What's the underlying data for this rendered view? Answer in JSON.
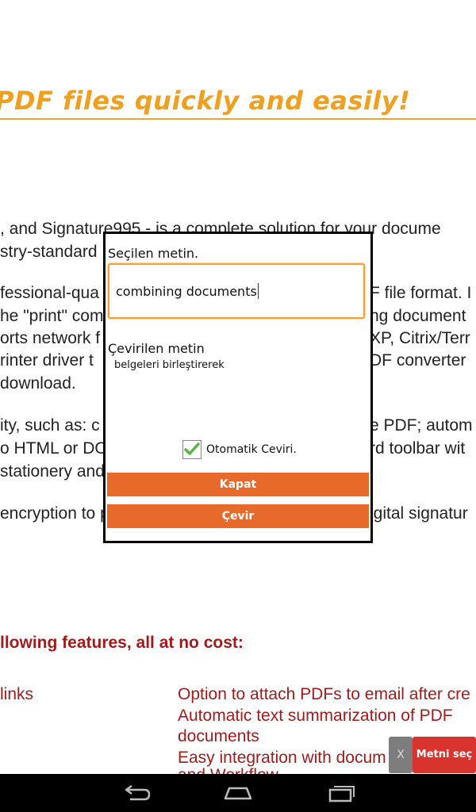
{
  "page": {
    "headline": "PDF files quickly and easily!",
    "body_lines": [
      ", and Signature995 - is a complete solution for your docume",
      "stry-standard",
      "fessional-qua",
      "he \"print\" com",
      "orts network f",
      "rinter driver t",
      "download.",
      "ity, such as: c",
      "o HTML or DO",
      "stationery and",
      "encryption to p"
    ],
    "body_right_lines": [
      "F file format. I",
      "ng document",
      "XP, Citrix/Terr",
      "DF converter",
      "e PDF; autom",
      "rd toolbar wit",
      "igital signatur"
    ],
    "features_heading": "llowing features, all at no cost:",
    "features_left": [
      "links"
    ],
    "features_right": [
      "Option to attach PDFs to email after cre",
      "Automatic text summarization of PDF",
      "documents",
      "Easy integration with docum",
      "and Workflow"
    ]
  },
  "dialog": {
    "source_label": "Seçilen metin.",
    "source_value": "combining documents",
    "translated_label": "Çevirilen metin",
    "translated_value": "belgeleri birleştirerek",
    "auto_label": "Otomatik Ceviri.",
    "auto_checked": true,
    "close_label": "Kapat",
    "translate_label": "Çevir"
  },
  "floating": {
    "dismiss_label": "X",
    "select_label": "Metni seç"
  },
  "colors": {
    "accent": "#e86a2a",
    "headline": "#f0a020",
    "feature_text": "#a01c1c",
    "select_button": "#d9332e"
  },
  "icons": {
    "nav_back": "back-icon",
    "nav_home": "home-icon",
    "nav_recents": "recents-icon",
    "check": "check-icon"
  }
}
